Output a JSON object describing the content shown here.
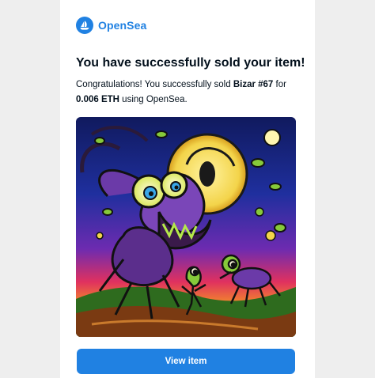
{
  "brand": {
    "name": "OpenSea",
    "color": "#2081e2"
  },
  "email": {
    "headline": "You have successfully sold your item!",
    "message_prefix": "Congratulations! You successfully sold ",
    "item_name": "Bizar #67",
    "message_mid": " for",
    "price": "0.006 ETH",
    "message_suffix": " using OpenSea."
  },
  "artwork": {
    "icon": "psychedelic-creature-artwork"
  },
  "actions": {
    "view_item_label": "View item"
  }
}
